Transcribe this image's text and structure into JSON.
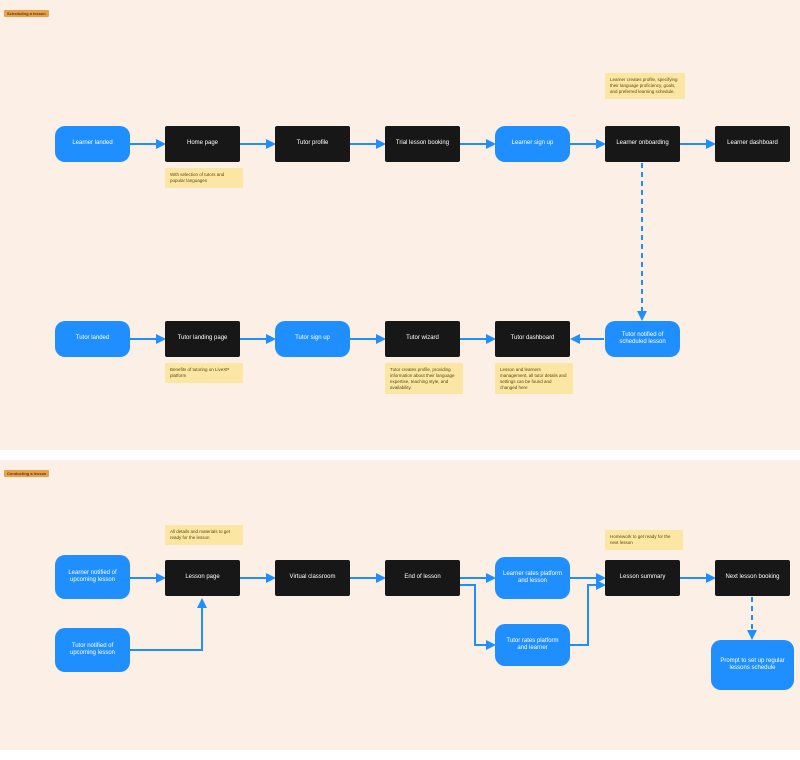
{
  "panels": {
    "scheduling": {
      "title": "Scheduling a lesson",
      "learner_row": {
        "learner_landed": "Learner landed",
        "home_page": "Home page",
        "tutor_profile": "Tutor profile",
        "trial_booking": "Trial lesson booking",
        "learner_signup": "Learner sign up",
        "learner_onboarding": "Learner onboarding",
        "learner_dashboard": "Learner dashboard"
      },
      "tutor_row": {
        "tutor_landed": "Tutor landed",
        "tutor_landing_page": "Tutor landing page",
        "tutor_signup": "Tutor sign up",
        "tutor_wizard": "Tutor wizard",
        "tutor_dashboard": "Tutor dashboard",
        "tutor_notified": "Tutor notified of scheduled lesson"
      },
      "notes": {
        "home_page": "With selection of tutors and popular languages",
        "onboarding": "Learner creates profile, specifying their language proficiency, goals, and preferred learning schedule.",
        "tutor_landing": "Benefits of tutoring on LiveXP platform",
        "tutor_wizard": "Tutor creates profile, providing information about their language expertise, teaching style, and availability.",
        "tutor_dashboard": "Lesson and learners management, all tutor details and settings can be found and changed here"
      }
    },
    "conducting": {
      "title": "Conducting a lesson",
      "nodes": {
        "learner_notified": "Learner notified of upcoming lesson",
        "tutor_notified": "Tutor notified of upcoming lesson",
        "lesson_page": "Lesson page",
        "virtual_classroom": "Virtual classroom",
        "end_of_lesson": "End of lesson",
        "learner_rates": "Learner rates platform and lesson",
        "tutor_rates": "Tutor rates platform and learner",
        "lesson_summary": "Lesson summary",
        "next_booking": "Next lesson booking",
        "prompt_schedule": "Prompt to set up regular lessons schedule"
      },
      "notes": {
        "lesson_page": "All details and materials to get ready for the lesson",
        "summary": "Homework to get ready for the next lesson"
      }
    }
  },
  "colors": {
    "blue": "#1f8fff",
    "black": "#171717",
    "note": "#fbe7a3",
    "panel_bg": "#fcefe5"
  }
}
